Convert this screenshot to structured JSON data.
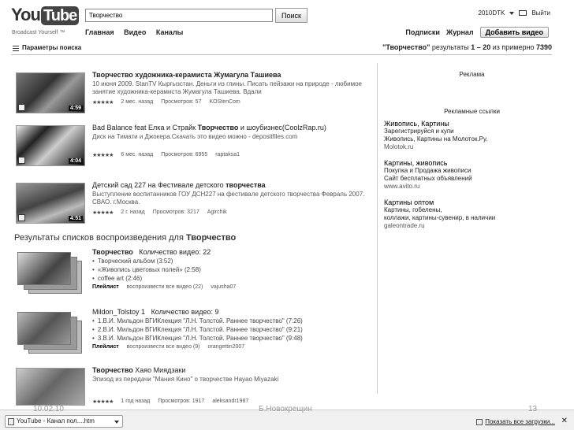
{
  "header": {
    "logo_you": "You",
    "logo_tube": "Tube",
    "tagline": "Broadcast Yourself ™",
    "search_value": "Творчество",
    "search_button": "Поиск",
    "nav": [
      "Главная",
      "Видео",
      "Каналы"
    ],
    "user": "2010DTK",
    "logout": "Выйти",
    "right_nav": [
      "Подписки",
      "Журнал"
    ],
    "upload_button": "Добавить видео"
  },
  "filter": {
    "label": "Параметры поиска",
    "results_query": "\"Творчество\"",
    "results_text_a": " результаты ",
    "results_range": "1 – 20",
    "results_text_b": " из примерно ",
    "results_total": "7390"
  },
  "videos": [
    {
      "title_a": "Творчество",
      "title_b": " художника-керамиста Жумагула Ташиева",
      "desc": "10 июня 2009. StanTV Кыргызстан. Деньги из глины. Писать пейзажи на природе - любимое занятие художника-керамиста Жумагула Ташиева. Вдали",
      "stars": "★★★★★",
      "age": "2 мес. назад",
      "views": "Просмотров: 57",
      "user": "KOStenCom",
      "duration": "4:59"
    },
    {
      "title_a": "Bad Balance feat Елка и Страйк ",
      "title_b": "Творчество",
      "title_c": " и шоубизнес(CoolzRap.ru)",
      "desc": "Диск на Тимати и Джокера.Скачать это видео можно - depositfiles.com",
      "stars": "★★★★★",
      "age": "6 мес. назад",
      "views": "Просмотров: 6955",
      "user": "raptaksa1",
      "duration": "4:04"
    },
    {
      "title_a": "Детский сад 227 на Фестивале детского ",
      "title_b": "творчества",
      "desc": "Выступление воспитанников ГОУ ДСН227 на фестивале детского творчества Февраль 2007. СВАО. г.Москва.",
      "stars": "★★★★★",
      "age": "2 г. назад",
      "views": "Просмотров: 3217",
      "user": "Agirchik",
      "duration": "4:51"
    }
  ],
  "playlists_section": {
    "title_a": "Результаты списков воспроизведения для ",
    "title_b": "Творчество"
  },
  "playlists": [
    {
      "title": "Творчество",
      "count_label": "Количество видео: 22",
      "items": [
        "Творческий альбом (3:52)",
        "«Живопись цветовых полей» (2:58)",
        "coffee art (2:46)"
      ],
      "foot_label": "Плейлист",
      "foot_play": "воспроизвести все видео (22)",
      "foot_user": "vajusha07"
    },
    {
      "title": "Mildon_Tolstoy 1",
      "count_label": "Количество видео: 9",
      "items": [
        "1.В.И. Мильдон ВГИКлекция \"Л.Н. Толстой. Раннее творчество\" (7:26)",
        "2.В.И. Мильдон ВГИКлекция \"Л.Н. Толстой. Раннее творчество\" (9:21)",
        "3.В.И. Мильдон ВГИКлекция \"Л.Н. Толстой. Раннее творчество\" (9:48)"
      ],
      "foot_label": "Плейлист",
      "foot_play": "воспроизвести все видео (9)",
      "foot_user": "orangettin2007"
    }
  ],
  "last_video": {
    "title_a": "Творчество",
    "title_b": " Хаяо Миядзаки",
    "desc": "Эпизод из передачи \"Мания Кино\" о творчестве Hayao Miyazaki",
    "stars": "★★★★★",
    "age": "1 год назад",
    "views": "Просмотров: 1917",
    "user": "aleksandr1987"
  },
  "ads": {
    "head": "Реклама",
    "links_head": "Рекламные ссылки",
    "blocks": [
      {
        "h": "Живопись, Картины",
        "l1": "Зарегистрируйся и купи",
        "l2": "Живопись, Картины на Молоток.Ру.",
        "u": "Molotok.ru"
      },
      {
        "h": "Картины, живопись",
        "l1": "Покупка и Продажа живописи",
        "l2": "Сайт бесплатных объявлений",
        "u": "www.avito.ru"
      },
      {
        "h": "Картины оптом",
        "l1": "Картины, гобелены,",
        "l2": "коллажи, картины-сувенир, в наличии",
        "u": "galeontrade.ru"
      }
    ]
  },
  "slide": {
    "date": "10.02.10",
    "author": "Б.Новокрещин",
    "num": "13"
  },
  "download_bar": {
    "tab_label": "YouTube - Канал пол....htm",
    "show_all": "Показать все загрузки...",
    "close": "✕"
  }
}
